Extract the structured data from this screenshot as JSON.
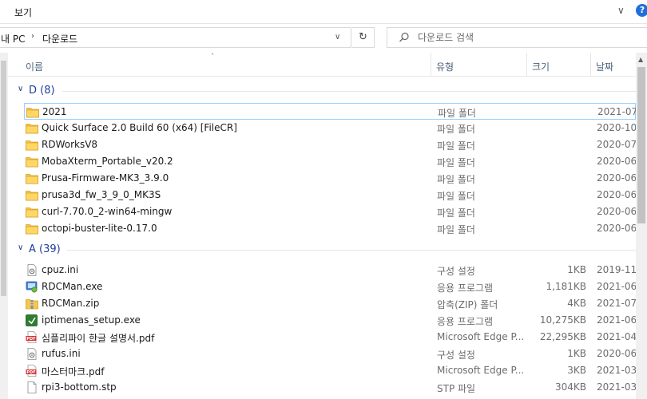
{
  "ribbon": {
    "tab_label": "보기",
    "expand_glyph": "∨",
    "help_glyph": "?"
  },
  "address": {
    "crumbs": [
      "내 PC",
      "다운로드"
    ],
    "separator": "›",
    "dropdown_glyph": "∨",
    "refresh_glyph": "↻"
  },
  "search": {
    "placeholder": "다운로드 검색"
  },
  "columns": {
    "name": "이름",
    "type": "유형",
    "size": "크기",
    "date": "날짜"
  },
  "groups": [
    {
      "title": "D (8)",
      "items": [
        {
          "name": "2021",
          "type": "파일 폴더",
          "size": "",
          "date": "2021-07",
          "icon": "folder-icon"
        },
        {
          "name": "Quick Surface 2.0 Build 60 (x64) [FileCR]",
          "type": "파일 폴더",
          "size": "",
          "date": "2020-10",
          "icon": "folder-icon"
        },
        {
          "name": "RDWorksV8",
          "type": "파일 폴더",
          "size": "",
          "date": "2020-07",
          "icon": "folder-icon"
        },
        {
          "name": "MobaXterm_Portable_v20.2",
          "type": "파일 폴더",
          "size": "",
          "date": "2020-06",
          "icon": "folder-icon"
        },
        {
          "name": "Prusa-Firmware-MK3_3.9.0",
          "type": "파일 폴더",
          "size": "",
          "date": "2020-06",
          "icon": "folder-icon"
        },
        {
          "name": "prusa3d_fw_3_9_0_MK3S",
          "type": "파일 폴더",
          "size": "",
          "date": "2020-06",
          "icon": "folder-icon"
        },
        {
          "name": "curl-7.70.0_2-win64-mingw",
          "type": "파일 폴더",
          "size": "",
          "date": "2020-06",
          "icon": "folder-icon"
        },
        {
          "name": "octopi-buster-lite-0.17.0",
          "type": "파일 폴더",
          "size": "",
          "date": "2020-06",
          "icon": "folder-icon"
        }
      ]
    },
    {
      "title": "A (39)",
      "items": [
        {
          "name": "cpuz.ini",
          "type": "구성 설정",
          "size": "1KB",
          "date": "2019-11",
          "icon": "settings-file-icon"
        },
        {
          "name": "RDCMan.exe",
          "type": "응용 프로그램",
          "size": "1,181KB",
          "date": "2021-06",
          "icon": "app-exe-icon"
        },
        {
          "name": "RDCMan.zip",
          "type": "압축(ZIP) 폴더",
          "size": "4KB",
          "date": "2021-07",
          "icon": "zip-folder-icon"
        },
        {
          "name": "iptimenas_setup.exe",
          "type": "응용 프로그램",
          "size": "10,275KB",
          "date": "2021-06",
          "icon": "installer-icon"
        },
        {
          "name": "심플리파이 한글 설명서.pdf",
          "type": "Microsoft Edge P...",
          "size": "22,295KB",
          "date": "2021-04",
          "icon": "pdf-icon"
        },
        {
          "name": "rufus.ini",
          "type": "구성 설정",
          "size": "1KB",
          "date": "2020-06",
          "icon": "settings-file-icon"
        },
        {
          "name": "마스터마크.pdf",
          "type": "Microsoft Edge P...",
          "size": "3KB",
          "date": "2021-03",
          "icon": "pdf-icon"
        },
        {
          "name": "rpi3-bottom.stp",
          "type": "STP 파일",
          "size": "304KB",
          "date": "2021-03",
          "icon": "generic-file-icon"
        }
      ]
    }
  ],
  "colors": {
    "group_title": "#1e3f9a",
    "selection_border": "#99d1ff",
    "folder": "#f4c84d"
  }
}
